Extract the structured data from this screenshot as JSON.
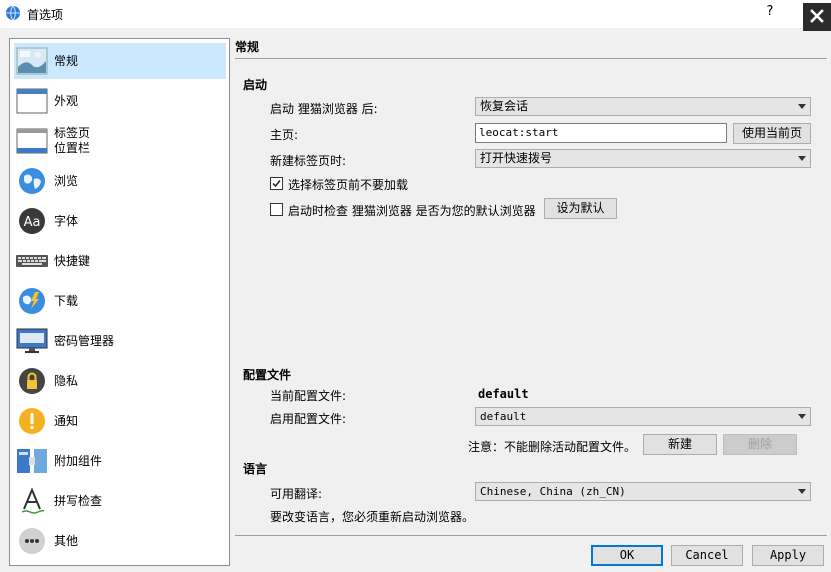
{
  "window": {
    "title": "首选项",
    "help_label": "?",
    "close_label": "✕"
  },
  "sidebar": {
    "items": [
      {
        "label": "常规",
        "icon": "general-icon"
      },
      {
        "label": "外观",
        "icon": "appearance-icon"
      },
      {
        "label": "标签页\n位置栏",
        "icon": "tabs-icon"
      },
      {
        "label": "浏览",
        "icon": "browse-globe-icon"
      },
      {
        "label": "字体",
        "icon": "font-icon"
      },
      {
        "label": "快捷键",
        "icon": "keyboard-icon"
      },
      {
        "label": "下载",
        "icon": "download-globe-icon"
      },
      {
        "label": "密码管理器",
        "icon": "monitor-icon"
      },
      {
        "label": "隐私",
        "icon": "privacy-icon"
      },
      {
        "label": "通知",
        "icon": "notification-icon"
      },
      {
        "label": "附加组件",
        "icon": "addons-icon"
      },
      {
        "label": "拼写检查",
        "icon": "spellcheck-icon"
      },
      {
        "label": "其他",
        "icon": "other-icon"
      }
    ]
  },
  "main": {
    "title": "常规",
    "startup": {
      "heading": "启动",
      "after_launch_label": "启动 狸猫浏览器 后:",
      "after_launch_value": "恢复会话",
      "homepage_label": "主页:",
      "homepage_value": "leocat:start",
      "use_current_label": "使用当前页",
      "new_tab_label": "新建标签页时:",
      "new_tab_value": "打开快速拨号",
      "dont_load_label": "选择标签页前不要加载",
      "dont_load_checked": true,
      "check_default_label": "启动时检查 狸猫浏览器 是否为您的默认浏览器",
      "check_default_checked": false,
      "set_default_label": "设为默认"
    },
    "profiles": {
      "heading": "配置文件",
      "current_label": "当前配置文件:",
      "current_value": "default",
      "startup_label": "启用配置文件:",
      "startup_value": "default",
      "note": "注意：不能删除活动配置文件。",
      "new_label": "新建",
      "delete_label": "删除"
    },
    "language": {
      "heading": "语言",
      "available_label": "可用翻译:",
      "available_value": "Chinese, China (zh_CN)",
      "restart_note": "要改变语言，您必须重新启动浏览器。"
    }
  },
  "footer": {
    "ok_label": "OK",
    "cancel_label": "Cancel",
    "apply_label": "Apply"
  }
}
